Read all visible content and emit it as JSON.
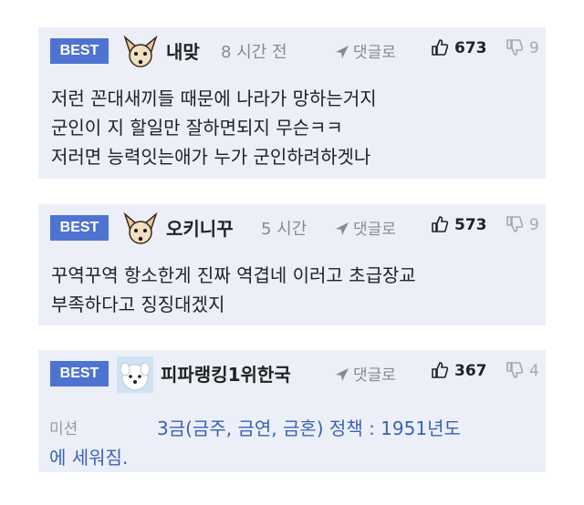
{
  "comments": [
    {
      "badge": "BEST",
      "avatar": "fennec-fox-avatar",
      "username": "내맞",
      "time": "8 시간 전",
      "reply_label": "댓글로",
      "likes": "673",
      "dislikes": "9",
      "lines": [
        "저런 꼰대새끼들 때문에 나라가 망하는거지",
        "군인이 지 할일만 잘하면되지 무슨ㅋㅋ",
        "저러면 능력잇는애가 누가 군인하려하겟나"
      ]
    },
    {
      "badge": "BEST",
      "avatar": "fennec-fox-avatar",
      "username": "오키니꾸",
      "time": "5 시간",
      "reply_label": "댓글로",
      "likes": "573",
      "dislikes": "9",
      "lines": [
        "꾸역꾸역 항소한게 진짜 역겹네 이러고 초급장교",
        "부족하다고 징징대겠지"
      ]
    },
    {
      "badge": "BEST",
      "avatar": "white-dog-avatar",
      "username": "피파랭킹1위한국",
      "reply_label": "댓글로",
      "likes": "367",
      "dislikes": "4",
      "mission_label": "미션",
      "link_line1": "3금(금주, 금연, 금혼) 정책 : 1951년도",
      "link_line2": "에 세워짐."
    }
  ],
  "colors": {
    "badge": "#4f73d0",
    "card_bg": "#eceff8",
    "link": "#3a62b8"
  }
}
